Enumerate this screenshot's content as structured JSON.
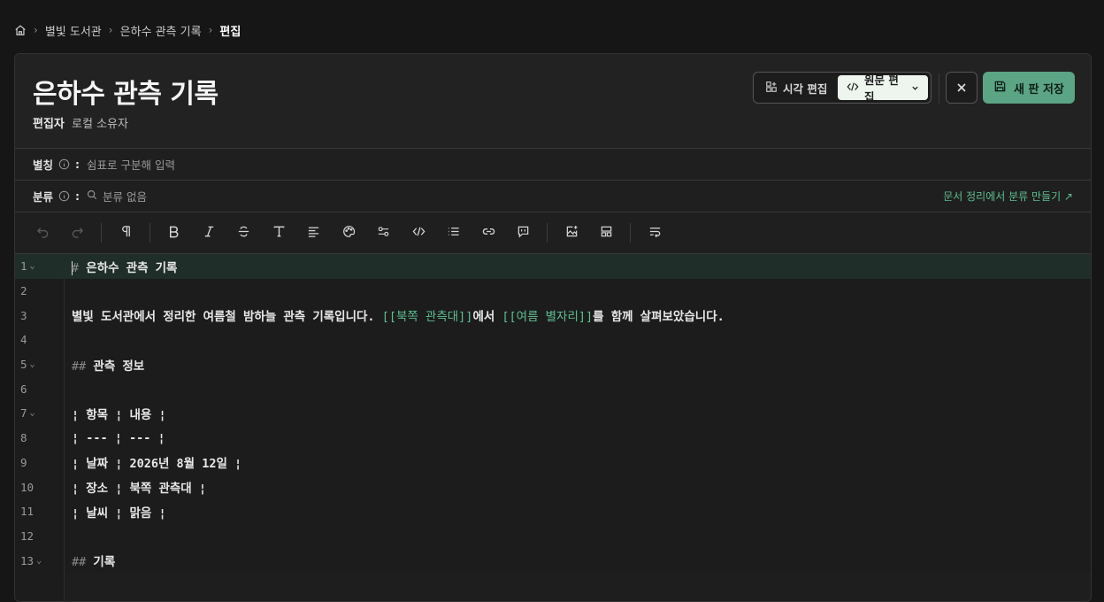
{
  "breadcrumb": {
    "items": [
      "별빛 도서관",
      "은하수 관측 기록"
    ],
    "current": "편집"
  },
  "header": {
    "title": "은하수 관측 기록",
    "editor_label": "편집자",
    "editor_value": "로컬 소유자",
    "mode_visual": "시각 편집",
    "mode_source": "원문 편집",
    "save_label": "새 판 저장"
  },
  "fields": {
    "alias_label": "별칭",
    "alias_placeholder": "쉼표로 구분해 입력",
    "category_label": "분류",
    "category_empty": "분류 없음",
    "category_link": "문서 정리에서 분류 만들기 ↗"
  },
  "colors": {
    "accent": "#5ba584",
    "link": "#5fbf92",
    "active_line": "#1f2e29"
  },
  "editor": {
    "lines": [
      {
        "n": "1",
        "fold": true,
        "mk": "#",
        "text": " 은하수 관측 기록"
      },
      {
        "n": "2",
        "text": ""
      },
      {
        "n": "3",
        "pre": "별빛 도서관에서 정리한 여름철 밤하늘 관측 기록입니다. ",
        "link1": "[[북쪽 관측대]]",
        "mid": "에서 ",
        "link2": "[[여름 별자리]]",
        "post": "를 함께 살펴보았습니다."
      },
      {
        "n": "4",
        "text": ""
      },
      {
        "n": "5",
        "fold": true,
        "mk": "##",
        "text": " 관측 정보"
      },
      {
        "n": "6",
        "text": ""
      },
      {
        "n": "7",
        "fold": true,
        "text": "¦ 항목 ¦ 내용 ¦"
      },
      {
        "n": "8",
        "text": "¦ --- ¦ --- ¦"
      },
      {
        "n": "9",
        "text": "¦ 날짜 ¦ 2026년 8월 12일 ¦"
      },
      {
        "n": "10",
        "text": "¦ 장소 ¦ 북쪽 관측대 ¦"
      },
      {
        "n": "11",
        "text": "¦ 날씨 ¦ 맑음 ¦"
      },
      {
        "n": "12",
        "text": ""
      },
      {
        "n": "13",
        "fold": true,
        "mk": "##",
        "text": " 기록"
      }
    ]
  }
}
